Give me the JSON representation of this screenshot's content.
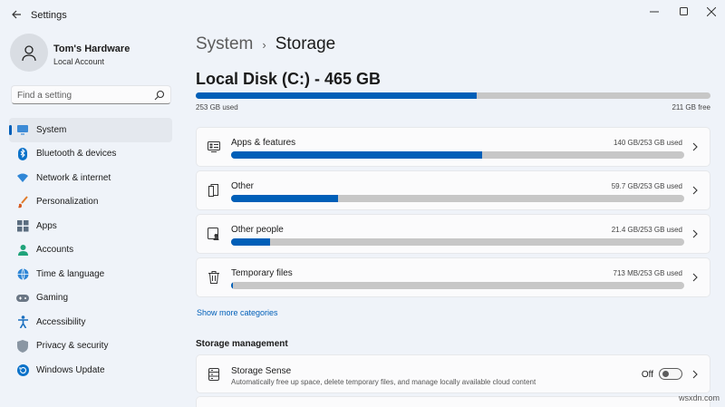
{
  "window": {
    "title": "Settings",
    "controls": {
      "minimize": "minimize-icon",
      "maximize": "maximize-icon",
      "close": "close-icon"
    }
  },
  "profile": {
    "name": "Tom's Hardware",
    "account_type": "Local Account"
  },
  "search": {
    "placeholder": "Find a setting"
  },
  "sidebar": {
    "items": [
      {
        "label": "System",
        "icon": "monitor-icon",
        "active": true
      },
      {
        "label": "Bluetooth & devices",
        "icon": "bluetooth-icon"
      },
      {
        "label": "Network & internet",
        "icon": "wifi-icon"
      },
      {
        "label": "Personalization",
        "icon": "brush-icon"
      },
      {
        "label": "Apps",
        "icon": "apps-icon"
      },
      {
        "label": "Accounts",
        "icon": "person-icon"
      },
      {
        "label": "Time & language",
        "icon": "globe-icon"
      },
      {
        "label": "Gaming",
        "icon": "gamepad-icon"
      },
      {
        "label": "Accessibility",
        "icon": "accessibility-icon"
      },
      {
        "label": "Privacy & security",
        "icon": "shield-icon"
      },
      {
        "label": "Windows Update",
        "icon": "update-icon"
      }
    ]
  },
  "breadcrumb": {
    "parent": "System",
    "separator": "›",
    "current": "Storage"
  },
  "disk": {
    "title": "Local Disk (C:) - 465 GB",
    "used_label": "253 GB used",
    "free_label": "211 GB free",
    "used_fraction": 0.545
  },
  "categories": [
    {
      "name": "Apps & features",
      "size": "140 GB/253 GB used",
      "fraction": 0.553,
      "icon": "apps-features-icon"
    },
    {
      "name": "Other",
      "size": "59.7 GB/253 GB used",
      "fraction": 0.236,
      "icon": "other-files-icon"
    },
    {
      "name": "Other people",
      "size": "21.4 GB/253 GB used",
      "fraction": 0.085,
      "icon": "other-people-icon"
    },
    {
      "name": "Temporary files",
      "size": "713 MB/253 GB used",
      "fraction": 0.003,
      "icon": "trash-icon"
    }
  ],
  "show_more": "Show more categories",
  "storage_management": {
    "title": "Storage management",
    "storage_sense": {
      "name": "Storage Sense",
      "description": "Automatically free up space, delete temporary files, and manage locally available cloud content",
      "toggle_label": "Off",
      "enabled": false
    }
  },
  "watermark": "wsxdn.com",
  "colors": {
    "accent": "#005fb8",
    "bar_track": "#c7c7c7",
    "background": "#eff3f9",
    "card": "#fbfbfc"
  }
}
